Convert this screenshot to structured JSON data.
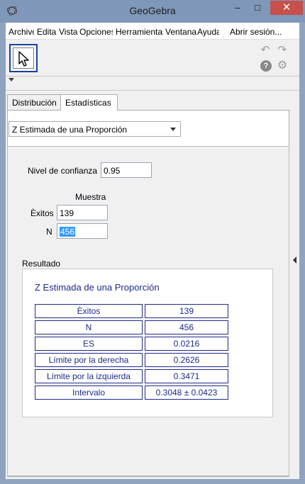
{
  "window": {
    "title": "GeoGebra",
    "minimize": "‒",
    "maximize": "□",
    "close": "✕"
  },
  "menubar": {
    "items": [
      "Archivo",
      "Edita",
      "Vista",
      "Opciones",
      "Herramientas",
      "Ventana",
      "Ayuda"
    ],
    "login": "Abrir sesión..."
  },
  "toolbar": {
    "undo_icon": "undo-icon",
    "redo_icon": "redo-icon",
    "help": "?",
    "settings_icon": "gear-icon"
  },
  "tabs": [
    "Distribución",
    "Estadísticas"
  ],
  "procedure": {
    "selected": "Z Estimada de una Proporción"
  },
  "form": {
    "confidence_label": "Nivel de confianza",
    "confidence_value": "0.95",
    "sample_header": "Muestra",
    "successes_label": "Èxitos",
    "successes_value": "139",
    "n_label": "N",
    "n_value": "456"
  },
  "result": {
    "label": "Resultado",
    "title": "Z Estimada de una Proporción",
    "rows": [
      {
        "key": "Èxitos",
        "value": "139"
      },
      {
        "key": "N",
        "value": "456"
      },
      {
        "key": "ES",
        "value": "0.0216"
      },
      {
        "key": "Límite por la derecha",
        "value": "0.2626"
      },
      {
        "key": "Límite por la izquierda",
        "value": "0.3471"
      },
      {
        "key": "Intervalo",
        "value": "0.3048 ± 0.0423"
      }
    ]
  }
}
